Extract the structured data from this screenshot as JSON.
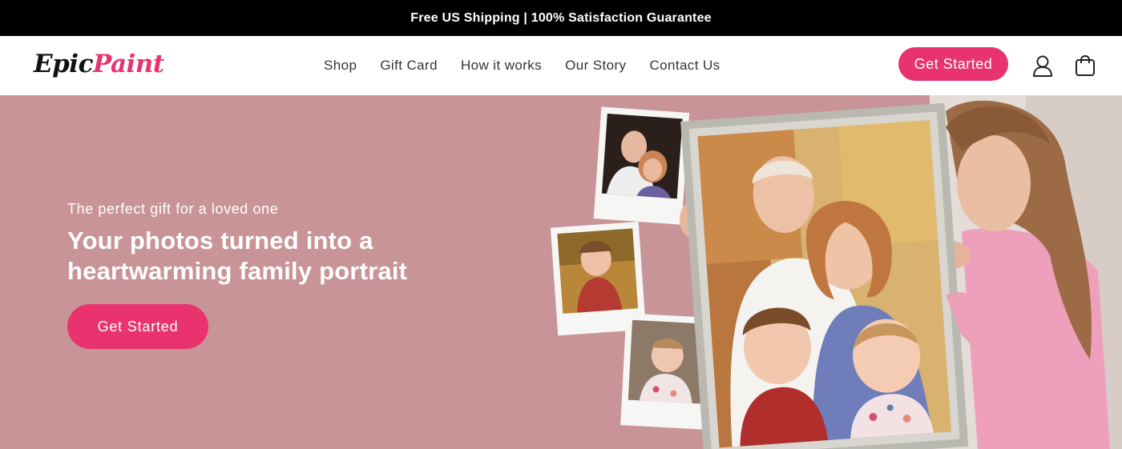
{
  "announcement": {
    "text": "Free US Shipping | 100% Satisfaction Guarantee"
  },
  "header": {
    "logo": {
      "part1": "Epic",
      "part2": "Paint"
    },
    "nav": [
      "Shop",
      "Gift Card",
      "How it works",
      "Our Story",
      "Contact Us"
    ],
    "cta_label": "Get Started",
    "icons": {
      "account": "user-icon",
      "cart": "shopping-bag-icon"
    }
  },
  "hero": {
    "subtitle": "The perfect gift for a loved one",
    "title": "Your photos turned into a heartwarming family portrait",
    "cta_label": "Get Started"
  },
  "colors": {
    "accent": "#e8336f",
    "hero_bg": "#c99497",
    "announce_bg": "#000000"
  }
}
